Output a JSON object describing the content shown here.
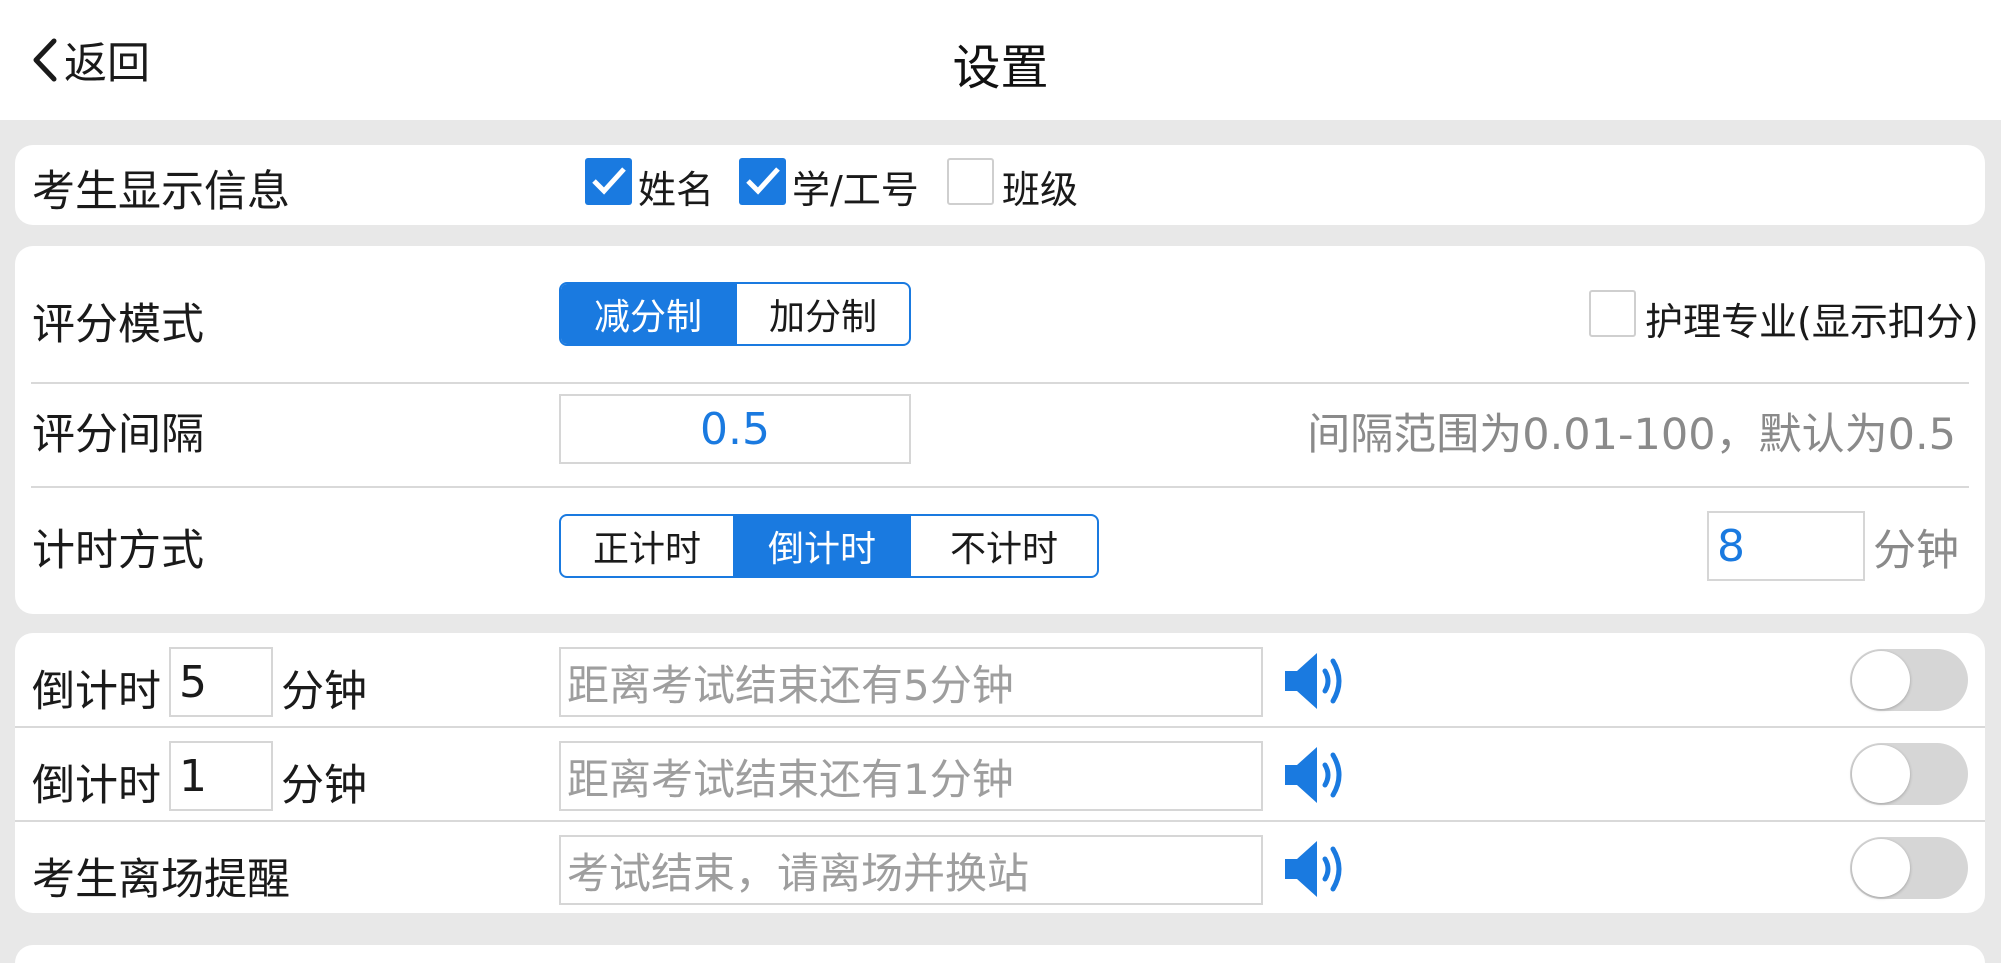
{
  "header": {
    "back_label": "返回",
    "title": "设置"
  },
  "display_info": {
    "label": "考生显示信息",
    "options": [
      {
        "label": "姓名",
        "checked": true
      },
      {
        "label": "学/工号",
        "checked": true
      },
      {
        "label": "班级",
        "checked": false
      }
    ]
  },
  "scoring_mode": {
    "label": "评分模式",
    "options": [
      "减分制",
      "加分制"
    ],
    "selected": "减分制",
    "nursing_label": "护理专业(显示扣分)",
    "nursing_checked": false
  },
  "score_interval": {
    "label": "评分间隔",
    "value": "0.5",
    "hint": "间隔范围为0.01-100，默认为0.5"
  },
  "timing": {
    "label": "计时方式",
    "options": [
      "正计时",
      "倒计时",
      "不计时"
    ],
    "selected": "倒计时",
    "minutes": "8",
    "unit": "分钟"
  },
  "reminders": [
    {
      "prefix": "倒计时",
      "minutes": "5",
      "unit": "分钟",
      "placeholder": "距离考试结束还有5分钟",
      "enabled": false
    },
    {
      "prefix": "倒计时",
      "minutes": "1",
      "unit": "分钟",
      "placeholder": "距离考试结束还有1分钟",
      "enabled": false
    },
    {
      "label": "考生离场提醒",
      "placeholder": "考试结束，请离场并换站",
      "enabled": false
    }
  ],
  "colors": {
    "accent": "#1a7ae0",
    "background": "#e8e8e8",
    "toggle_off": "#d6d6d6"
  },
  "icons": {
    "back": "chevron-left-icon",
    "speaker": "speaker-icon",
    "check": "checkmark-icon"
  }
}
